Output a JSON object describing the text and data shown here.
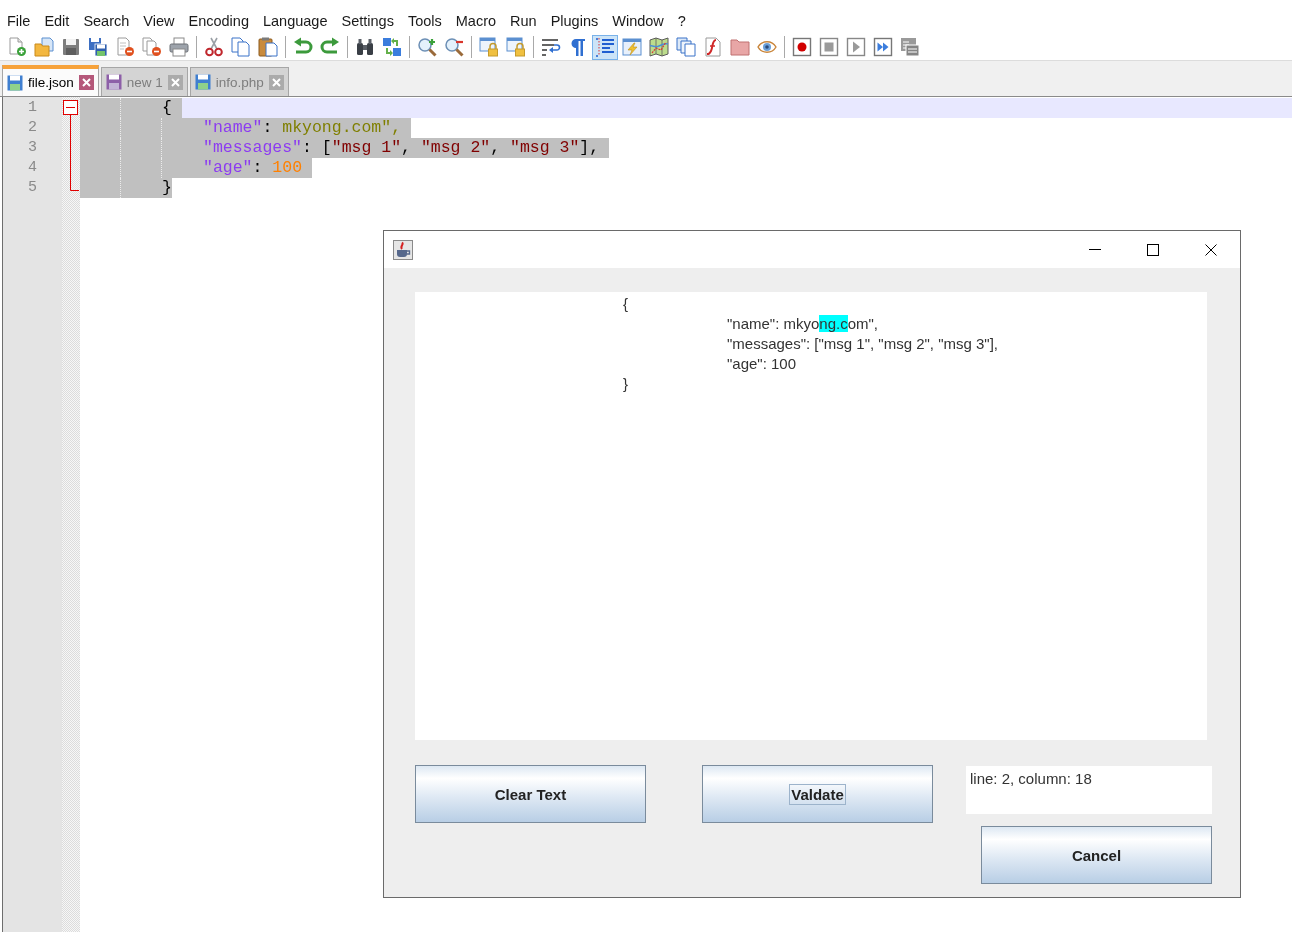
{
  "menu": {
    "items": [
      "File",
      "Edit",
      "Search",
      "View",
      "Encoding",
      "Language",
      "Settings",
      "Tools",
      "Macro",
      "Run",
      "Plugins",
      "Window",
      "?"
    ]
  },
  "toolbar": {
    "groups": [
      [
        {
          "checked": false
        },
        {
          "checked": false
        },
        {
          "checked": false
        },
        {
          "checked": false
        },
        {
          "checked": false
        },
        {
          "checked": false
        },
        {
          "checked": false
        }
      ],
      [
        {
          "checked": false
        },
        {
          "checked": false
        },
        {
          "checked": false
        }
      ],
      [
        {
          "checked": false
        },
        {
          "checked": false
        }
      ],
      [
        {
          "checked": false
        },
        {
          "checked": false
        }
      ],
      [
        {
          "checked": false
        },
        {
          "checked": false
        }
      ],
      [
        {
          "checked": false
        },
        {
          "checked": false
        }
      ],
      [
        {
          "checked": false
        },
        {
          "checked": false
        },
        {
          "checked": true
        },
        {
          "checked": false
        },
        {
          "checked": false
        },
        {
          "checked": false
        },
        {
          "checked": false
        },
        {
          "checked": false
        },
        {
          "checked": false
        }
      ],
      [
        {
          "checked": false
        },
        {
          "checked": false
        },
        {
          "checked": false
        },
        {
          "checked": false
        },
        {
          "checked": false
        }
      ]
    ]
  },
  "tabs": [
    {
      "label": "file.json",
      "selected": true,
      "saved": true
    },
    {
      "label": "new 1",
      "selected": false,
      "saved": false
    },
    {
      "label": "info.php",
      "selected": false,
      "saved": true
    }
  ],
  "editor": {
    "fold_expanded": true,
    "lines": [
      {
        "number": "1",
        "current": true,
        "selected": true,
        "tokens": [
          {
            "kind": "plain",
            "text": "\t\t{"
          }
        ]
      },
      {
        "number": "2",
        "current": false,
        "selected": true,
        "tokens": [
          {
            "kind": "key",
            "text": "\t\t\t\"name\""
          },
          {
            "kind": "plain",
            "text": ": "
          },
          {
            "kind": "invalid",
            "text": "mkyong.com\","
          }
        ]
      },
      {
        "number": "3",
        "current": false,
        "selected": true,
        "tokens": [
          {
            "kind": "key",
            "text": "\t\t\t\"messages\""
          },
          {
            "kind": "plain",
            "text": ": ["
          },
          {
            "kind": "string",
            "text": "\"msg 1\""
          },
          {
            "kind": "plain",
            "text": ", "
          },
          {
            "kind": "string",
            "text": "\"msg 2\""
          },
          {
            "kind": "plain",
            "text": ", "
          },
          {
            "kind": "string",
            "text": "\"msg 3\""
          },
          {
            "kind": "plain",
            "text": "],"
          }
        ]
      },
      {
        "number": "4",
        "current": false,
        "selected": true,
        "tokens": [
          {
            "kind": "key",
            "text": "\t\t\t\"age\""
          },
          {
            "kind": "plain",
            "text": ": "
          },
          {
            "kind": "number",
            "text": "100"
          }
        ]
      },
      {
        "number": "5",
        "current": false,
        "selected": true,
        "tokens": [
          {
            "kind": "plain",
            "text": "\t\t}"
          }
        ]
      }
    ]
  },
  "dialog": {
    "text_area": {
      "lines": [
        {
          "segments": [
            {
              "text": "\t\t{",
              "highlighted": false
            }
          ]
        },
        {
          "segments": [
            {
              "text": "\t\t\t\"name\": mkyo",
              "highlighted": false
            },
            {
              "text": "ng.c",
              "highlighted": true
            },
            {
              "text": "om\",",
              "highlighted": false
            }
          ]
        },
        {
          "segments": [
            {
              "text": "\t\t\t\"messages\": [\"msg 1\", \"msg 2\", \"msg 3\"],",
              "highlighted": false
            }
          ]
        },
        {
          "segments": [
            {
              "text": "\t\t\t\"age\": 100",
              "highlighted": false
            }
          ]
        },
        {
          "segments": [
            {
              "text": "\t\t}",
              "highlighted": false
            }
          ]
        }
      ]
    },
    "buttons": [
      {
        "label": "Clear Text",
        "focused": false
      },
      {
        "label": "Valdate",
        "focused": true
      },
      {
        "label": "Cancel",
        "focused": false
      }
    ],
    "status_field": {
      "value": "line: 2, column: 18"
    }
  }
}
